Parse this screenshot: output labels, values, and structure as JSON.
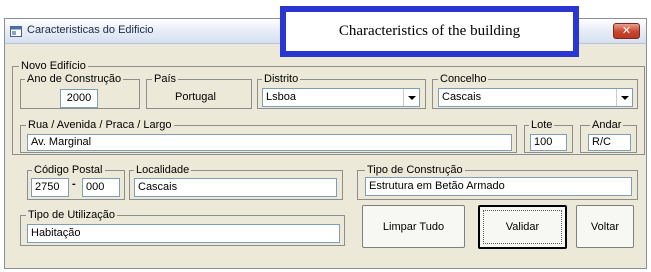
{
  "window": {
    "title": "Caracteristicas do Edificio",
    "close_symbol": "✕"
  },
  "overlay_label": "Characteristics of the building",
  "group_main": {
    "label": "Novo Edifício"
  },
  "ano": {
    "label": "Ano de Construção",
    "value": "2000"
  },
  "pais": {
    "label": "País",
    "value": "Portugal"
  },
  "distrito": {
    "label": "Distrito",
    "value": "Lsboa"
  },
  "concelho": {
    "label": "Concelho",
    "value": "Cascais"
  },
  "rua": {
    "label": "Rua / Avenida / Praca / Largo",
    "value": "Av. Marginal"
  },
  "lote": {
    "label": "Lote",
    "value": "100"
  },
  "andar": {
    "label": "Andar",
    "value": "R/C"
  },
  "codigo_postal": {
    "label": "Código Postal",
    "part1": "2750",
    "separator": "-",
    "part2": "000"
  },
  "localidade": {
    "label": "Localidade",
    "value": "Cascais"
  },
  "tipo_construcao": {
    "label": "Tipo de Construção",
    "value": "Estrutura em Betão Armado"
  },
  "tipo_utilizacao": {
    "label": "Tipo de Utilização",
    "value": "Habitação"
  },
  "buttons": {
    "limpar": "Limpar Tudo",
    "validar": "Validar",
    "voltar": "Voltar"
  },
  "icons": {
    "window": "window-app-icon",
    "close": "close-icon",
    "dropdown": "chevron-down-icon"
  }
}
